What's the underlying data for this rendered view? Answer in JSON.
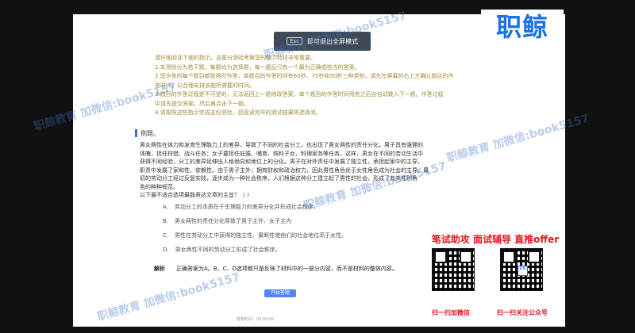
{
  "banner": {
    "esc_key": "Esc",
    "text": "即可退出全屏模式"
  },
  "instructions": [
    "请仔细阅读下面的指示，这部分测验考察您的能力特征非常重要。",
    "1.本测验分为若干题，每题均为选择题，每一题后只有一个最为正确或恰当的答案。",
    "2.您作答的每个题目都是限时作答，单题目的作答时间有60秒、75秒和90秒三种类别，请先在屏幕的右上方确认题目的作",
    "答时间，以合理安排该题所需要的时间。",
    "3.题目的作答过程是不可逆的，无法返回上一题修改答案，单个题目的作答时间用完之后会自动跳入下一题。作答过程",
    "中请先提交答案，然后再点击下一题。",
    "4.请按照这些指示完成这份测验，您阅读完毕的测试结果将选择测。"
  ],
  "example_label": "例题。",
  "passage": [
    "男女两性在体力和发育生理能力上的差异，导致了不同的社会分工，也出现了男女两性的责任分化。男子具有强健的",
    "体魄，担任狩猎、战斗任务；女子要担任妊娠、哺育、照料子女、料理家务等任务。这样，男女在不同的劳动生活中",
    "获得不同经验，分工的差异延伸出人格倾向和地位上的分化。男子在对外责任中发展了独立性，承担起家中的主导，",
    "职责中发展了家和性、依赖性。由于男子主外，拥有财权和政治权力，因此男性角色优于女性角色成为社会的主导。最",
    "初的劳动分工经过反复实践，逐步成为一种社会秩序，人们根据这种分工建立起了男性的社会，形成了有关性别角",
    "色的种种规范。",
    "以下最不适合选项最能表达文章的主旨？（ ）"
  ],
  "options": [
    {
      "letter": "A.",
      "text": "劳动分工的本质在于生理能力的差异分化并形成社会秩序。"
    },
    {
      "letter": "B.",
      "text": "男女两性的责任分化导致了男子主外、女子主内"
    },
    {
      "letter": "C.",
      "text": "男性在劳动分工中获得的独立性、果断性使他们的社会地位高于女性。"
    },
    {
      "letter": "D.",
      "text": "男女两性不同的劳动分工形成了社会秩序。"
    }
  ],
  "analysis": {
    "label": "解析",
    "text": "正确答案为A。B、C、D选项都只是反映了材料中的一部分内容，而不是材料的整体内容。"
  },
  "next_button": "开始答题",
  "footer": "答题时间：00:00:00",
  "logo": "职鲸",
  "promo": {
    "title": "笔试助攻  面试辅导  直推offer",
    "left_caption": "扫一扫加微信",
    "right_caption": "扫一扫关注公众号",
    "qr_center": "职鲸"
  },
  "watermark": "职鲸教育 加微信:book5157"
}
